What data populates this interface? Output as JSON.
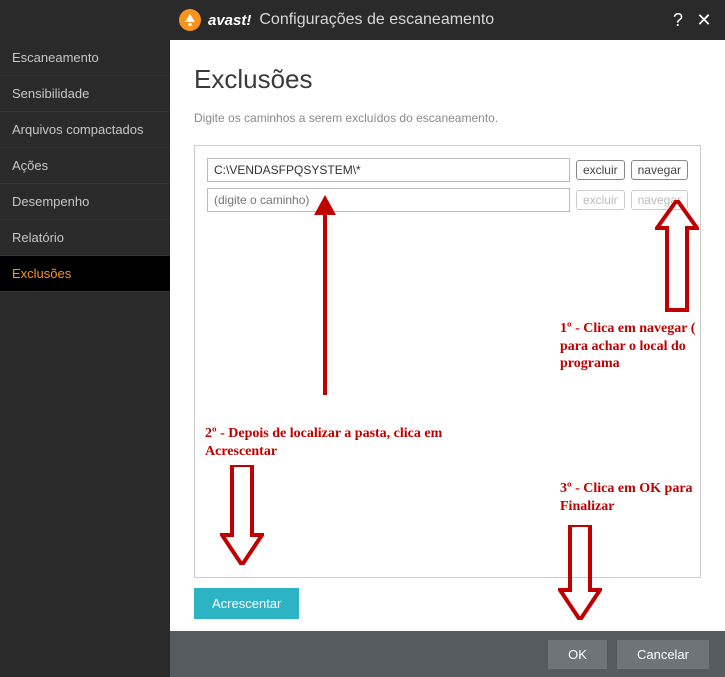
{
  "titlebar": {
    "brand": "avast!",
    "title": "Configurações de escaneamento",
    "help": "?",
    "close": "✕"
  },
  "sidebar": {
    "items": [
      {
        "label": "Escaneamento"
      },
      {
        "label": "Sensibilidade"
      },
      {
        "label": "Arquivos compactados"
      },
      {
        "label": "Ações"
      },
      {
        "label": "Desempenho"
      },
      {
        "label": "Relatório"
      },
      {
        "label": "Exclusões"
      }
    ],
    "activeIndex": 6
  },
  "page": {
    "title": "Exclusões",
    "desc": "Digite os caminhos a serem excluídos do escaneamento.",
    "rows": [
      {
        "value": "C:\\VENDASFPQSYSTEM\\*",
        "excluir": "excluir",
        "navegar": "navegar",
        "disabled": false
      },
      {
        "value": "",
        "placeholder": "(digite o caminho)",
        "excluir": "excluir",
        "navegar": "navegar",
        "disabled": true
      }
    ],
    "add": "Acrescentar"
  },
  "footer": {
    "ok": "OK",
    "cancel": "Cancelar"
  },
  "annotations": {
    "a1": "1º - Clica em navegar ( para achar o local do programa",
    "a2": "2º - Depois de localizar a pasta, clica em Acrescentar",
    "a3": "3º - Clica em OK para Finalizar"
  },
  "colors": {
    "accent": "#f7941e",
    "primaryBtn": "#2db4c4",
    "annotation": "#c00000"
  }
}
